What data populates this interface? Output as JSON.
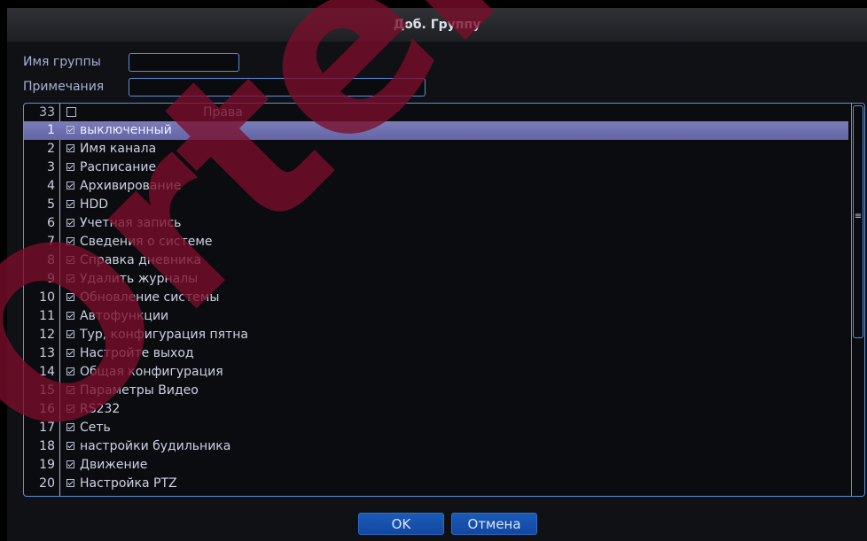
{
  "dialog": {
    "title": "Доб. Группу"
  },
  "form": {
    "group_name_label": "Имя группы",
    "group_name_value": "",
    "notes_label": "Примечания",
    "notes_value": ""
  },
  "list": {
    "header_count": "33",
    "header_label": "Права",
    "rows": [
      {
        "num": "1",
        "label": "выключенный"
      },
      {
        "num": "2",
        "label": "Имя канала"
      },
      {
        "num": "3",
        "label": "Расписание"
      },
      {
        "num": "4",
        "label": "Архивирование"
      },
      {
        "num": "5",
        "label": "HDD"
      },
      {
        "num": "6",
        "label": "Учетная запись"
      },
      {
        "num": "7",
        "label": "Сведения о системе"
      },
      {
        "num": "8",
        "label": "Справка дневника"
      },
      {
        "num": "9",
        "label": "Удалить журналы"
      },
      {
        "num": "10",
        "label": "Обновление системы"
      },
      {
        "num": "11",
        "label": "Автофункции"
      },
      {
        "num": "12",
        "label": "Тур, конфигурация пятна"
      },
      {
        "num": "13",
        "label": "Настройте выход"
      },
      {
        "num": "14",
        "label": "Общая конфигурация"
      },
      {
        "num": "15",
        "label": "Параметры Видео"
      },
      {
        "num": "16",
        "label": "RS232"
      },
      {
        "num": "17",
        "label": "Сеть"
      },
      {
        "num": "18",
        "label": "настройки будильника"
      },
      {
        "num": "19",
        "label": "Движение"
      },
      {
        "num": "20",
        "label": "Настройка PTZ"
      }
    ]
  },
  "buttons": {
    "ok": "OK",
    "cancel": "Отмена"
  },
  "watermark": {
    "text": "Ortek"
  }
}
